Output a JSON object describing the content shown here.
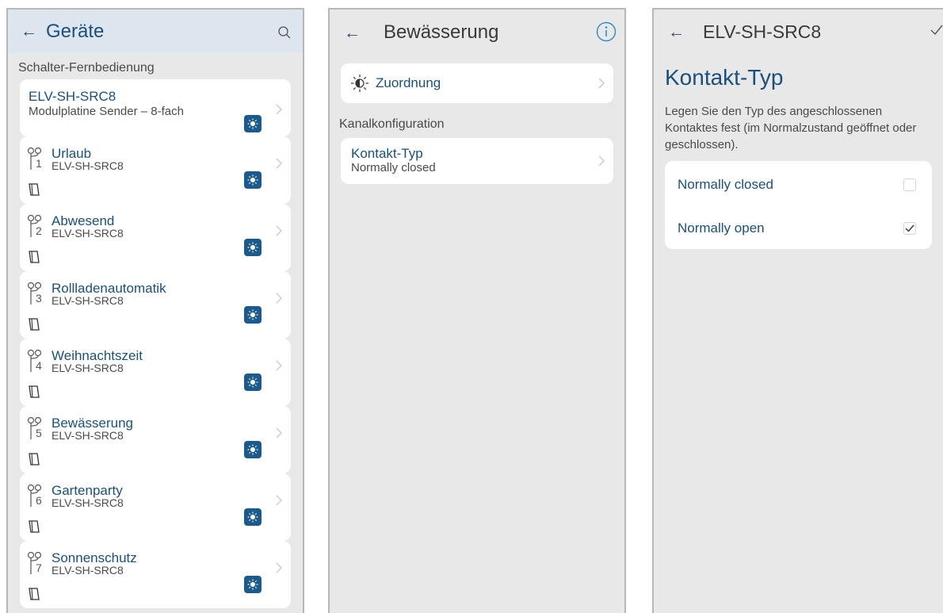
{
  "screen1": {
    "title": "Geräte",
    "section_label": "Schalter-Fernbedienung",
    "device": {
      "name": "ELV-SH-SRC8",
      "subtitle": "Modulplatine Sender – 8-fach"
    },
    "channels": [
      {
        "num": "1",
        "name": "Urlaub",
        "device": "ELV-SH-SRC8"
      },
      {
        "num": "2",
        "name": "Abwesend",
        "device": "ELV-SH-SRC8"
      },
      {
        "num": "3",
        "name": "Rollladenautomatik",
        "device": "ELV-SH-SRC8"
      },
      {
        "num": "4",
        "name": "Weihnachtszeit",
        "device": "ELV-SH-SRC8"
      },
      {
        "num": "5",
        "name": "Bewässerung",
        "device": "ELV-SH-SRC8"
      },
      {
        "num": "6",
        "name": "Gartenparty",
        "device": "ELV-SH-SRC8"
      },
      {
        "num": "7",
        "name": "Sonnenschutz",
        "device": "ELV-SH-SRC8"
      }
    ]
  },
  "screen2": {
    "title": "Bewässerung",
    "assign_label": "Zuordnung",
    "section_label": "Kanalkonfiguration",
    "contact_type": {
      "label": "Kontakt-Typ",
      "value": "Normally closed"
    }
  },
  "screen3": {
    "title": "ELV-SH-SRC8",
    "heading": "Kontakt-Typ",
    "description": "Legen Sie den Typ des angeschlossenen Kontaktes fest (im Normalzustand geöffnet oder geschlossen).",
    "options": [
      {
        "label": "Normally closed",
        "checked": false
      },
      {
        "label": "Normally open",
        "checked": true
      }
    ]
  },
  "colors": {
    "accent": "#19507e",
    "badge": "#1b5a8c",
    "header_bg": "#dde6ef",
    "screen_bg": "#e8e8e8"
  },
  "icons": [
    "back-arrow-icon",
    "search-icon",
    "chevron-right-icon",
    "sun-badge-icon",
    "channel-key-icon",
    "remote-icon",
    "info-icon",
    "sun-icon",
    "checkmark-icon"
  ]
}
